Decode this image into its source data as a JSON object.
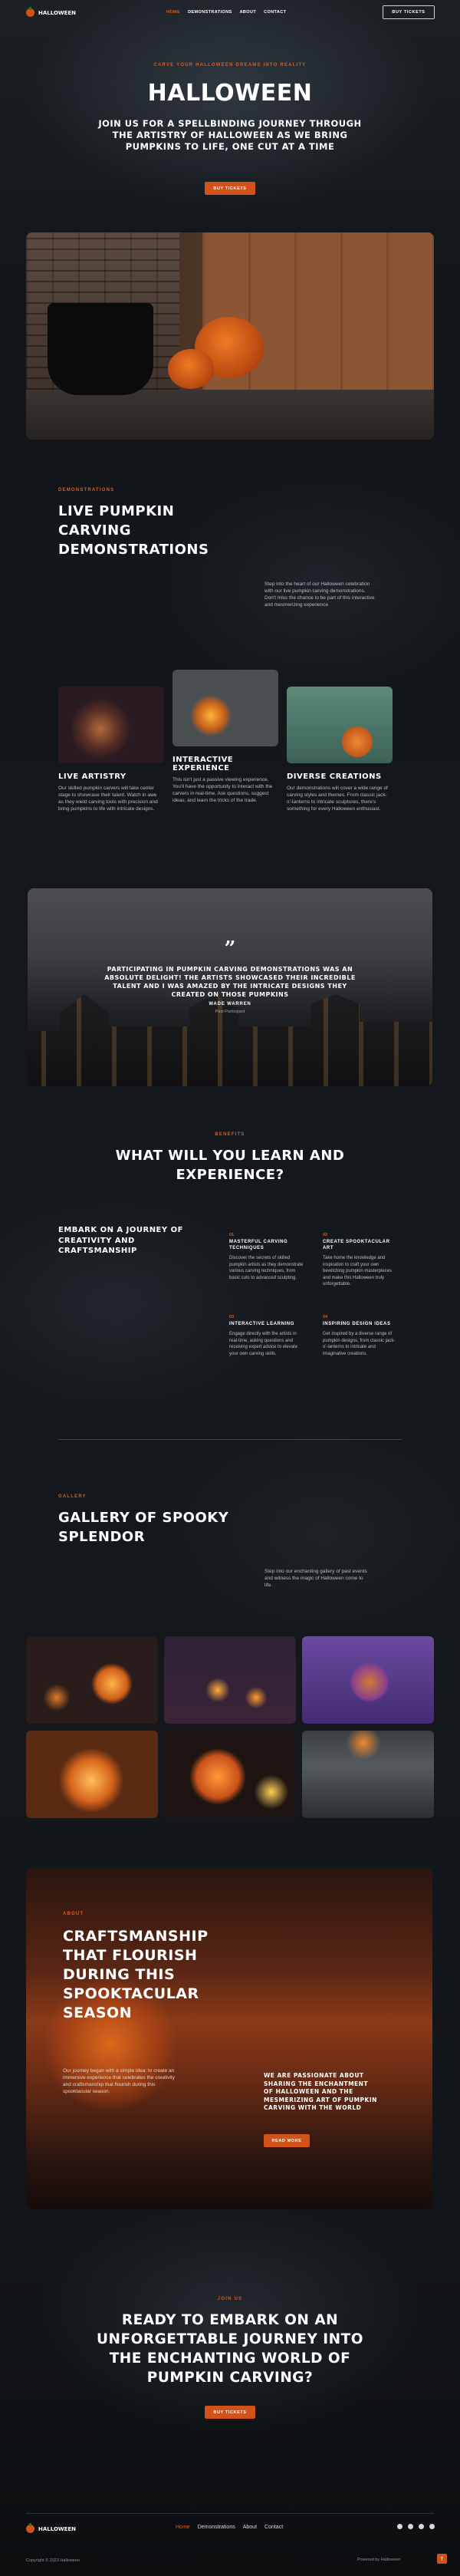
{
  "header": {
    "logo_text": "HALLOWEEN",
    "nav": [
      {
        "label": "HOME",
        "active": true
      },
      {
        "label": "DEMONSTRATIONS",
        "active": false
      },
      {
        "label": "ABOUT",
        "active": false
      },
      {
        "label": "CONTACT",
        "active": false
      }
    ],
    "cta": "BUY TICKETS"
  },
  "hero": {
    "kicker": "CARVE YOUR HALLOWEEN DREAMS INTO REALITY",
    "title": "HALLOWEEN",
    "subtitle": "JOIN US FOR A SPELLBINDING JOURNEY THROUGH THE ARTISTRY OF HALLOWEEN AS WE BRING PUMPKINS TO LIFE, ONE CUT AT A TIME",
    "button": "BUY TICKETS"
  },
  "demonstrations": {
    "kicker": "DEMONSTRATIONS",
    "title": "LIVE PUMPKIN CARVING DEMONSTRATIONS",
    "description": "Step into the heart of our Halloween celebration with our live pumpkin carving demonstrations. Don't miss the chance to be part of this interactive and mesmerizing experience",
    "cards": [
      {
        "title": "LIVE ARTISTRY",
        "text": "Our skilled pumpkin carvers will take center stage to showcase their talent. Watch in awe as they wield carving tools with precision and bring pumpkins to life with intricate designs."
      },
      {
        "title": "INTERACTIVE EXPERIENCE",
        "text": "This isn't just a passive viewing experience. You'll have the opportunity to interact with the carvers in real-time. Ask questions, suggest ideas, and learn the tricks of the trade."
      },
      {
        "title": "DIVERSE CREATIONS",
        "text": "Our demonstrations will cover a wide range of carving styles and themes. From classic jack-o'-lanterns to intricate sculptures, there's something for every Halloween enthusiast."
      }
    ]
  },
  "testimonial": {
    "quote_mark": "”",
    "text": "PARTICIPATING IN PUMPKIN CARVING DEMONSTRATIONS WAS AN ABSOLUTE DELIGHT! THE ARTISTS SHOWCASED THEIR INCREDIBLE TALENT AND I WAS AMAZED BY THE INTRICATE DESIGNS THEY CREATED ON THOSE PUMPKINS",
    "name": "WADE WARREN",
    "role": "Past Participant"
  },
  "benefits": {
    "kicker": "BENEFITS",
    "title": "WHAT WILL YOU LEARN AND EXPERIENCE?",
    "lead": "EMBARK ON A JOURNEY OF CREATIVITY AND CRAFTSMANSHIP",
    "items": [
      {
        "num": "01",
        "title": "MASTERFUL CARVING TECHNIQUES",
        "text": "Discover the secrets of skilled pumpkin artists as they demonstrate various carving techniques, from basic cuts to advanced sculpting."
      },
      {
        "num": "02",
        "title": "CREATE SPOOKTACULAR ART",
        "text": "Take home the knowledge and inspiration to craft your own bewitching pumpkin masterpieces and make this Halloween truly unforgettable."
      },
      {
        "num": "03",
        "title": "INTERACTIVE LEARNING",
        "text": "Engage directly with the artists in real-time, asking questions and receiving expert advice to elevate your own carving skills."
      },
      {
        "num": "04",
        "title": "INSPIRING DESIGN IDEAS",
        "text": "Get inspired by a diverse range of pumpkin designs, from classic jack-o'-lanterns to intricate and imaginative creations."
      }
    ]
  },
  "gallery": {
    "kicker": "GALLERY",
    "title": "GALLERY OF SPOOKY SPLENDOR",
    "description": "Step into our enchanting gallery of past events and witness the magic of Halloween come to life."
  },
  "about": {
    "kicker": "ABOUT",
    "title": "CRAFTSMANSHIP THAT FLOURISH DURING THIS SPOOKTACULAR SEASON",
    "body": "Our journey began with a simple idea: to create an immersive experience that celebrates the creativity and craftsmanship that flourish during this spooktacular season.",
    "right_heading": "WE ARE PASSIONATE ABOUT SHARING THE ENCHANTMENT OF HALLOWEEN AND THE MESMERIZING ART OF PUMPKIN CARVING WITH THE WORLD",
    "button": "READ MORE"
  },
  "cta": {
    "kicker": "JOIN US",
    "title": "READY TO EMBARK ON AN UNFORGETTABLE JOURNEY INTO THE ENCHANTING WORLD OF PUMPKIN CARVING?",
    "button": "BUY TICKETS"
  },
  "footer": {
    "logo_text": "HALLOWEEN",
    "nav": [
      {
        "label": "Home",
        "active": true
      },
      {
        "label": "Demonstrations",
        "active": false
      },
      {
        "label": "About",
        "active": false
      },
      {
        "label": "Contact",
        "active": false
      }
    ],
    "copyright": "Copyright © 2023 Halloween",
    "powered": "Powered by Halloween",
    "to_top": "↑"
  },
  "colors": {
    "accent": "#d2521a",
    "background": "#121519"
  }
}
